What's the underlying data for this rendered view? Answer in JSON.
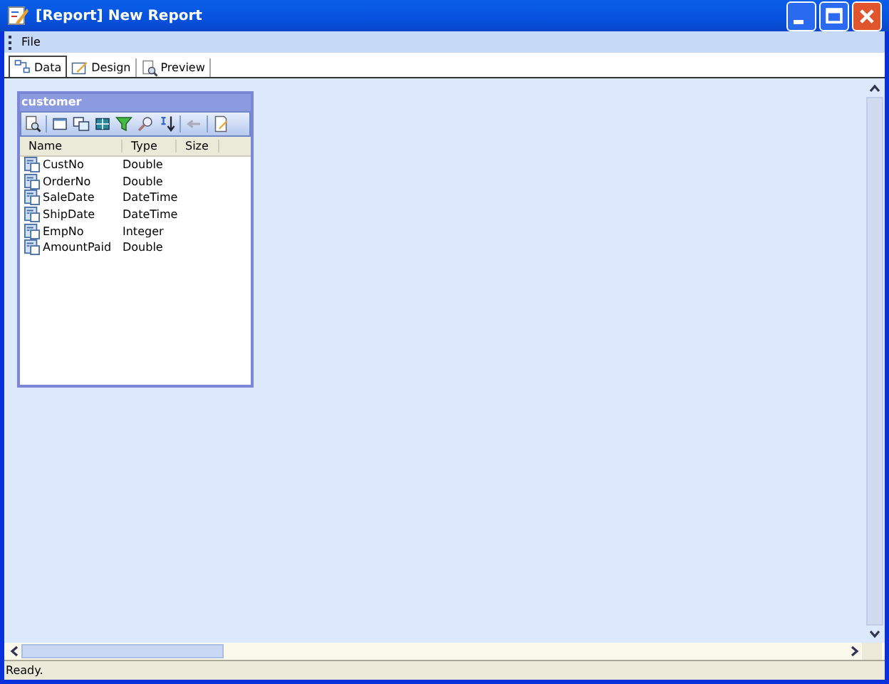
{
  "window": {
    "title": "[Report] New Report"
  },
  "menu": [
    "File"
  ],
  "tabs": [
    {
      "label": "Data",
      "selected": true
    },
    {
      "label": "Design",
      "selected": false
    },
    {
      "label": "Preview",
      "selected": false
    }
  ],
  "table_panel": {
    "title": "customer",
    "columns": [
      "Name",
      "Type",
      "Size"
    ],
    "rows": [
      {
        "name": "CustNo",
        "type": "Double"
      },
      {
        "name": "OrderNo",
        "type": "Double"
      },
      {
        "name": "SaleDate",
        "type": "DateTime"
      },
      {
        "name": "ShipDate",
        "type": "DateTime"
      },
      {
        "name": "EmpNo",
        "type": "Integer"
      },
      {
        "name": "AmountPaid",
        "type": "Double"
      }
    ]
  },
  "status_bar": "Ready."
}
